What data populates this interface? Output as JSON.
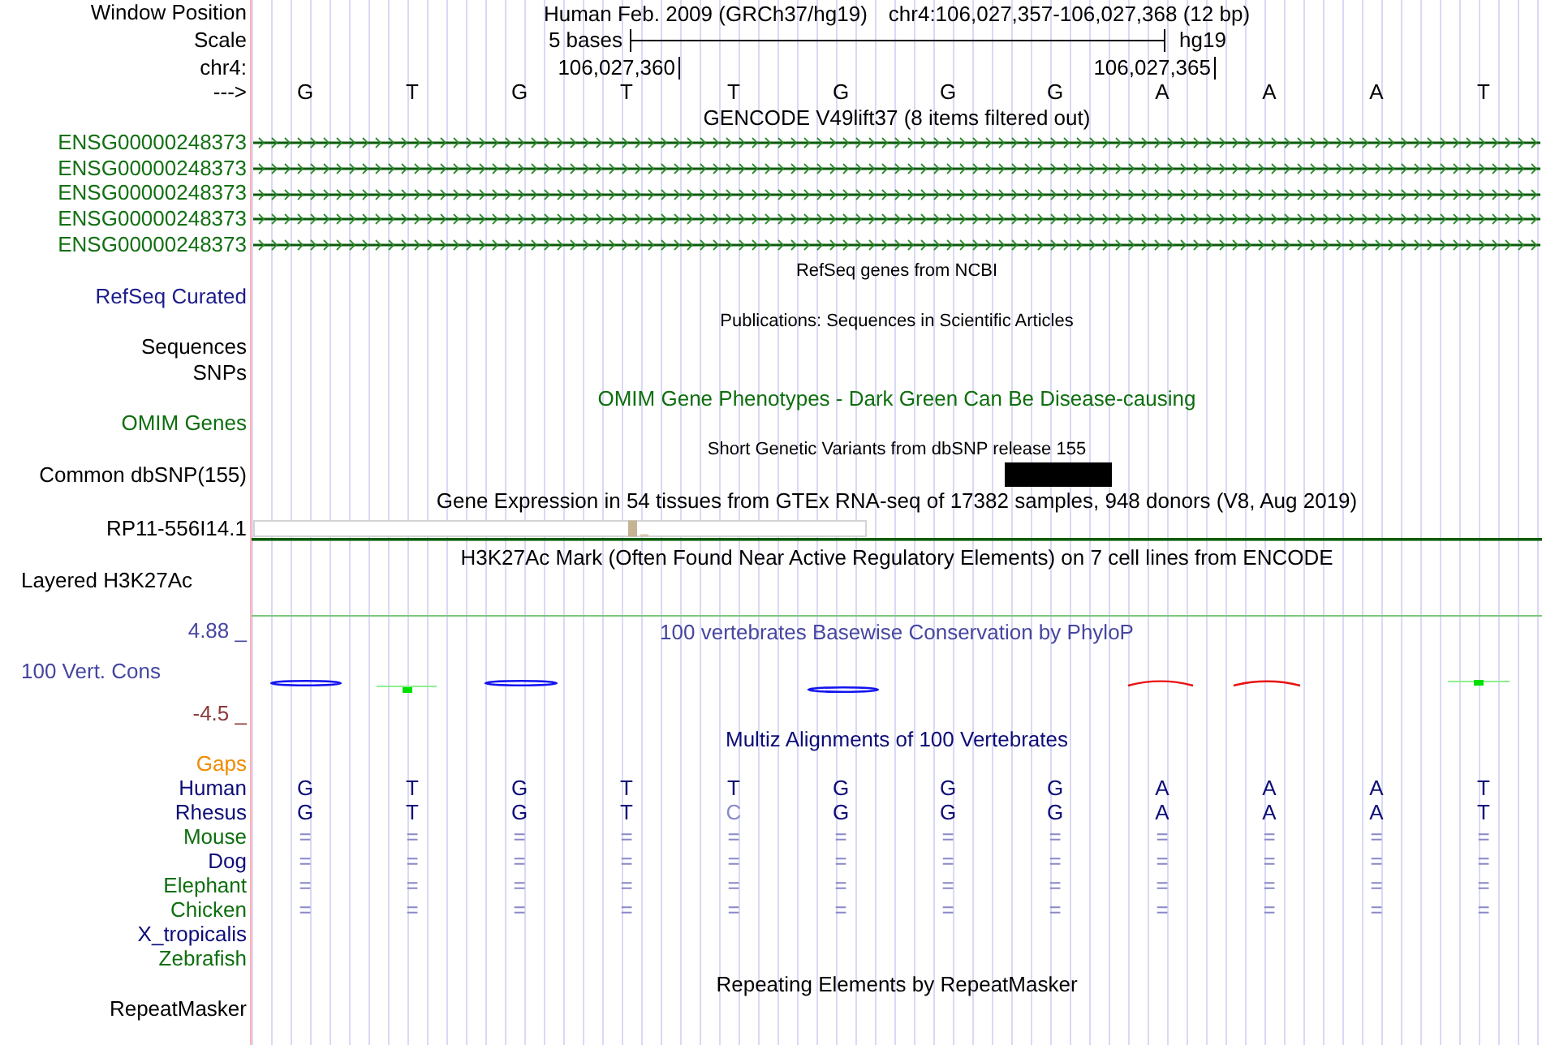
{
  "position": {
    "label": "Window Position",
    "assembly": "Human Feb. 2009 (GRCh37/hg19)",
    "range": "chr4:106,027,357-106,027,368 (12 bp)"
  },
  "scale": {
    "label": "Scale",
    "span": "5 bases",
    "genome": "hg19"
  },
  "ruler": {
    "label": "chr4:",
    "ticks": [
      "106,027,360",
      "106,027,365"
    ]
  },
  "sequence": {
    "label": "--->",
    "bases": [
      "G",
      "T",
      "G",
      "T",
      "T",
      "G",
      "G",
      "G",
      "A",
      "A",
      "A",
      "T"
    ]
  },
  "tracks": [
    {
      "kind": "genes",
      "title": {
        "text": "GENCODE V49lift37 (8 items filtered out)",
        "color": "#000000"
      },
      "super_track": false,
      "color": "#137013",
      "labels": [
        "ENSG00000248373",
        "ENSG00000248373",
        "ENSG00000248373",
        "ENSG00000248373",
        "ENSG00000248373"
      ]
    },
    {
      "kind": "labels",
      "title": {
        "text": "RefSeq genes from NCBI",
        "color": "#000000"
      },
      "super_track": true,
      "color": "#1c1c8c",
      "labels": [
        "RefSeq Curated"
      ]
    },
    {
      "kind": "labels",
      "title": {
        "text": "Publications: Sequences in Scientific Articles",
        "color": "#000000"
      },
      "super_track": true,
      "color": "#000000",
      "labels": [
        "Sequences",
        "SNPs"
      ]
    },
    {
      "kind": "labels",
      "title": {
        "text": "OMIM Gene Phenotypes - Dark Green Can Be Disease-causing",
        "color": "#0e6e0e"
      },
      "super_track": false,
      "color": "#0e6e0e",
      "labels": [
        "OMIM Genes"
      ]
    },
    {
      "kind": "variants",
      "title": {
        "text": "Short Genetic Variants from dbSNP release 155",
        "color": "#000000"
      },
      "super_track": true,
      "color": "#000000",
      "labels": [
        "Common dbSNP(155)"
      ]
    },
    {
      "kind": "expression",
      "title": {
        "text": "Gene Expression in 54 tissues from GTEx RNA-seq of 17382 samples, 948 donors (V8, Aug 2019)",
        "color": "#000000"
      },
      "super_track": false,
      "color": "#000000",
      "labels": [
        "RP11-556I14.1"
      ]
    },
    {
      "kind": "signal",
      "title": {
        "text": "H3K27Ac Mark (Often Found Near Active Regulatory Elements) on 7 cell lines from ENCODE",
        "color": "#000000"
      },
      "super_track": false,
      "color": "#000000",
      "labels": [
        "Layered H3K27Ac"
      ]
    },
    {
      "kind": "conservation",
      "title": {
        "text": "100 vertebrates Basewise Conservation by PhyloP",
        "color": "#4646a0"
      },
      "super_track": false,
      "color": "#4646a0",
      "labels": [
        "100 Vert. Cons"
      ],
      "range_top": {
        "text": "4.88 _",
        "color": "#4646a0"
      },
      "range_bottom": {
        "text": "-4.5 _",
        "color": "#8c3a3a"
      }
    },
    {
      "kind": "alignment",
      "title": {
        "text": "Multiz Alignments of 100 Vertebrates",
        "color": "#0c0c78"
      },
      "super_track": false,
      "gaps": {
        "label": "Gaps",
        "color": "#f08a00"
      },
      "species": [
        {
          "name": "Human",
          "color": "#0c0c78",
          "bases": [
            {
              "text": "G",
              "faint": false
            },
            {
              "text": "T",
              "faint": false
            },
            {
              "text": "G",
              "faint": false
            },
            {
              "text": "T",
              "faint": false
            },
            {
              "text": "T",
              "faint": false
            },
            {
              "text": "G",
              "faint": false
            },
            {
              "text": "G",
              "faint": false
            },
            {
              "text": "G",
              "faint": false
            },
            {
              "text": "A",
              "faint": false
            },
            {
              "text": "A",
              "faint": false
            },
            {
              "text": "A",
              "faint": false
            },
            {
              "text": "T",
              "faint": false
            }
          ]
        },
        {
          "name": "Rhesus",
          "color": "#0c0c78",
          "bases": [
            {
              "text": "G",
              "faint": false
            },
            {
              "text": "T",
              "faint": false
            },
            {
              "text": "G",
              "faint": false
            },
            {
              "text": "T",
              "faint": false
            },
            {
              "text": "C",
              "faint": true
            },
            {
              "text": "G",
              "faint": false
            },
            {
              "text": "G",
              "faint": false
            },
            {
              "text": "G",
              "faint": false
            },
            {
              "text": "A",
              "faint": false
            },
            {
              "text": "A",
              "faint": false
            },
            {
              "text": "A",
              "faint": false
            },
            {
              "text": "T",
              "faint": false
            }
          ]
        },
        {
          "name": "Mouse",
          "color": "#0e6e0e",
          "bases": [
            {
              "text": "=",
              "faint": true
            },
            {
              "text": "=",
              "faint": true
            },
            {
              "text": "=",
              "faint": true
            },
            {
              "text": "=",
              "faint": true
            },
            {
              "text": "=",
              "faint": true
            },
            {
              "text": "=",
              "faint": true
            },
            {
              "text": "=",
              "faint": true
            },
            {
              "text": "=",
              "faint": true
            },
            {
              "text": "=",
              "faint": true
            },
            {
              "text": "=",
              "faint": true
            },
            {
              "text": "=",
              "faint": true
            },
            {
              "text": "=",
              "faint": true
            }
          ]
        },
        {
          "name": "Dog",
          "color": "#0c0c78",
          "bases": [
            {
              "text": "=",
              "faint": true
            },
            {
              "text": "=",
              "faint": true
            },
            {
              "text": "=",
              "faint": true
            },
            {
              "text": "=",
              "faint": true
            },
            {
              "text": "=",
              "faint": true
            },
            {
              "text": "=",
              "faint": true
            },
            {
              "text": "=",
              "faint": true
            },
            {
              "text": "=",
              "faint": true
            },
            {
              "text": "=",
              "faint": true
            },
            {
              "text": "=",
              "faint": true
            },
            {
              "text": "=",
              "faint": true
            },
            {
              "text": "=",
              "faint": true
            }
          ]
        },
        {
          "name": "Elephant",
          "color": "#0e6e0e",
          "bases": [
            {
              "text": "=",
              "faint": true
            },
            {
              "text": "=",
              "faint": true
            },
            {
              "text": "=",
              "faint": true
            },
            {
              "text": "=",
              "faint": true
            },
            {
              "text": "=",
              "faint": true
            },
            {
              "text": "=",
              "faint": true
            },
            {
              "text": "=",
              "faint": true
            },
            {
              "text": "=",
              "faint": true
            },
            {
              "text": "=",
              "faint": true
            },
            {
              "text": "=",
              "faint": true
            },
            {
              "text": "=",
              "faint": true
            },
            {
              "text": "=",
              "faint": true
            }
          ]
        },
        {
          "name": "Chicken",
          "color": "#0e6e0e",
          "bases": [
            {
              "text": "=",
              "faint": true
            },
            {
              "text": "=",
              "faint": true
            },
            {
              "text": "=",
              "faint": true
            },
            {
              "text": "=",
              "faint": true
            },
            {
              "text": "=",
              "faint": true
            },
            {
              "text": "=",
              "faint": true
            },
            {
              "text": "=",
              "faint": true
            },
            {
              "text": "=",
              "faint": true
            },
            {
              "text": "=",
              "faint": true
            },
            {
              "text": "=",
              "faint": true
            },
            {
              "text": "=",
              "faint": true
            },
            {
              "text": "=",
              "faint": true
            }
          ]
        },
        {
          "name": "X_tropicalis",
          "color": "#0c0c78"
        },
        {
          "name": "Zebrafish",
          "color": "#0e6e0e"
        }
      ]
    },
    {
      "kind": "labels",
      "title": {
        "text": "Repeating Elements by RepeatMasker",
        "color": "#000000"
      },
      "super_track": false,
      "color": "#000000",
      "labels": [
        "RepeatMasker"
      ]
    }
  ]
}
